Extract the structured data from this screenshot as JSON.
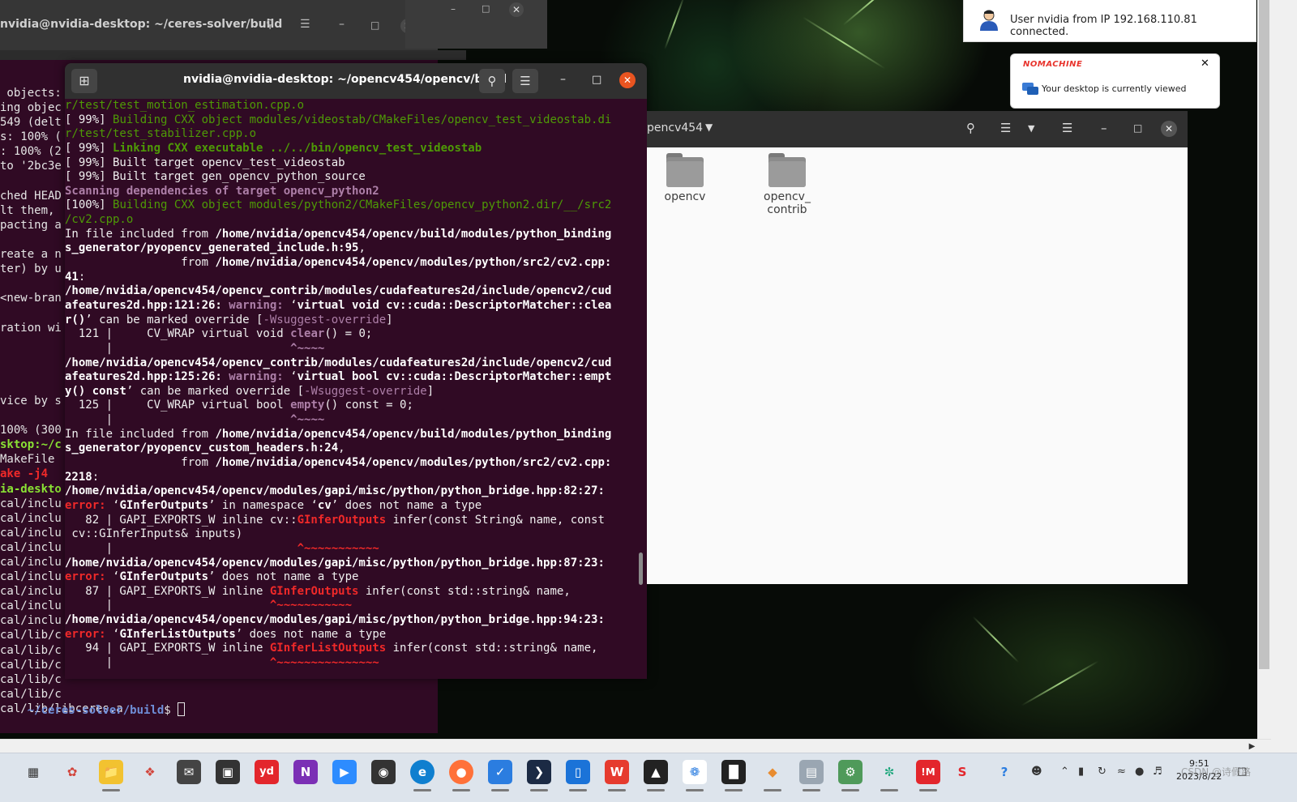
{
  "back_terminal": {
    "title": "nvidia@nvidia-desktop: ~/ceres-solver/build",
    "lines": [
      " objects:",
      "ing objec",
      "549 (delt",
      "s: 100% (",
      ": 100% (2",
      "to '2bc3e",
      "",
      "ched HEAD",
      "lt them,",
      "pacting a",
      "",
      "reate a n",
      "ter) by u",
      "",
      "<new-bran",
      "",
      "ration wi",
      "",
      "",
      "",
      "",
      "vice by s",
      "",
      "100% (300"
    ],
    "blue_lines": [
      "sktop:~/c",
      "MakeFile",
      "ake -j4",
      "ia-deskto"
    ],
    "lib_lines": [
      "cal/inclu",
      "cal/inclu",
      "cal/inclu",
      "cal/inclu",
      "cal/inclu",
      "cal/inclu",
      "cal/inclu",
      "cal/inclu",
      "cal/inclu",
      "cal/lib/c",
      "cal/lib/c",
      "cal/lib/c",
      "cal/lib/c",
      "cal/lib/c",
      "cal/lib/libceres.a"
    ],
    "prompt_path": "~/ceres-solver/build",
    "prompt_suffix": "$ "
  },
  "main_terminal": {
    "title": "nvidia@nvidia-desktop: ~/opencv454/opencv/build",
    "lines": [
      [
        {
          "t": "r/test/test_motion_estimation.cpp.o",
          "c": "g"
        }
      ],
      [
        {
          "t": "[ 99%] ",
          "c": ""
        },
        {
          "t": "Building CXX object modules/videostab/CMakeFiles/opencv_test_videostab.di",
          "c": "g"
        }
      ],
      [
        {
          "t": "r/test/test_stabilizer.cpp.o",
          "c": "g"
        }
      ],
      [
        {
          "t": "[ 99%] ",
          "c": ""
        },
        {
          "t": "Linking CXX executable ../../bin/opencv_test_videostab",
          "c": "gb"
        }
      ],
      [
        {
          "t": "[ 99%] Built target opencv_test_videostab",
          "c": ""
        }
      ],
      [
        {
          "t": "[ 99%] Built target gen_opencv_python_source",
          "c": ""
        }
      ],
      [
        {
          "t": "Scanning dependencies of target opencv_python2",
          "c": "pb"
        }
      ],
      [
        {
          "t": "[100%] ",
          "c": ""
        },
        {
          "t": "Building CXX object modules/python2/CMakeFiles/opencv_python2.dir/__/src2",
          "c": "g"
        }
      ],
      [
        {
          "t": "/cv2.cpp.o",
          "c": "g"
        }
      ],
      [
        {
          "t": "In file included from ",
          "c": ""
        },
        {
          "t": "/home/nvidia/opencv454/opencv/build/modules/python_binding",
          "c": "b"
        }
      ],
      [
        {
          "t": "s_generator/pyopencv_generated_include.h:95",
          "c": "b"
        },
        {
          "t": ",",
          "c": ""
        }
      ],
      [
        {
          "t": "                 from ",
          "c": ""
        },
        {
          "t": "/home/nvidia/opencv454/opencv/modules/python/src2/cv2.cpp:",
          "c": "b"
        }
      ],
      [
        {
          "t": "41",
          "c": "b"
        },
        {
          "t": ":",
          "c": ""
        }
      ],
      [
        {
          "t": "/home/nvidia/opencv454/opencv_contrib/modules/cudafeatures2d/include/opencv2/cud",
          "c": "b"
        }
      ],
      [
        {
          "t": "afeatures2d.hpp:121:26:",
          "c": "b"
        },
        {
          "t": " warning: ",
          "c": "pb"
        },
        {
          "t": "‘",
          "c": ""
        },
        {
          "t": "virtual void cv::cuda::DescriptorMatcher::clea",
          "c": "b"
        }
      ],
      [
        {
          "t": "r()",
          "c": "b"
        },
        {
          "t": "’ can be marked override [",
          "c": ""
        },
        {
          "t": "-Wsuggest-override",
          "c": "purple"
        },
        {
          "t": "]",
          "c": ""
        }
      ],
      [
        {
          "t": "  121 |     CV_WRAP virtual void ",
          "c": ""
        },
        {
          "t": "clear",
          "c": "pb"
        },
        {
          "t": "() = 0;",
          "c": ""
        }
      ],
      [
        {
          "t": "      |                          ",
          "c": ""
        },
        {
          "t": "^~~~~",
          "c": "pb"
        }
      ],
      [
        {
          "t": "/home/nvidia/opencv454/opencv_contrib/modules/cudafeatures2d/include/opencv2/cud",
          "c": "b"
        }
      ],
      [
        {
          "t": "afeatures2d.hpp:125:26:",
          "c": "b"
        },
        {
          "t": " warning: ",
          "c": "pb"
        },
        {
          "t": "‘",
          "c": ""
        },
        {
          "t": "virtual bool cv::cuda::DescriptorMatcher::empt",
          "c": "b"
        }
      ],
      [
        {
          "t": "y() const",
          "c": "b"
        },
        {
          "t": "’ can be marked override [",
          "c": ""
        },
        {
          "t": "-Wsuggest-override",
          "c": "purple"
        },
        {
          "t": "]",
          "c": ""
        }
      ],
      [
        {
          "t": "  125 |     CV_WRAP virtual bool ",
          "c": ""
        },
        {
          "t": "empty",
          "c": "pb"
        },
        {
          "t": "() const = 0;",
          "c": ""
        }
      ],
      [
        {
          "t": "      |                          ",
          "c": ""
        },
        {
          "t": "^~~~~",
          "c": "pb"
        }
      ],
      [
        {
          "t": "In file included from ",
          "c": ""
        },
        {
          "t": "/home/nvidia/opencv454/opencv/build/modules/python_binding",
          "c": "b"
        }
      ],
      [
        {
          "t": "s_generator/pyopencv_custom_headers.h:24",
          "c": "b"
        },
        {
          "t": ",",
          "c": ""
        }
      ],
      [
        {
          "t": "                 from ",
          "c": ""
        },
        {
          "t": "/home/nvidia/opencv454/opencv/modules/python/src2/cv2.cpp:",
          "c": "b"
        }
      ],
      [
        {
          "t": "2218",
          "c": "b"
        },
        {
          "t": ":",
          "c": ""
        }
      ],
      [
        {
          "t": "/home/nvidia/opencv454/opencv/modules/gapi/misc/python/python_bridge.hpp:82:27:",
          "c": "b"
        }
      ],
      [
        {
          "t": "error: ",
          "c": "rb"
        },
        {
          "t": "‘",
          "c": ""
        },
        {
          "t": "GInferOutputs",
          "c": "b"
        },
        {
          "t": "’ in namespace ‘",
          "c": ""
        },
        {
          "t": "cv",
          "c": "b"
        },
        {
          "t": "’ does not name a type",
          "c": ""
        }
      ],
      [
        {
          "t": "   82 | GAPI_EXPORTS_W inline cv::",
          "c": ""
        },
        {
          "t": "GInferOutputs",
          "c": "rb"
        },
        {
          "t": " infer(const String& name, const",
          "c": ""
        }
      ],
      [
        {
          "t": " cv::GInferInputs& inputs)",
          "c": ""
        }
      ],
      [
        {
          "t": "      |                           ",
          "c": ""
        },
        {
          "t": "^~~~~~~~~~~~",
          "c": "rb"
        }
      ],
      [
        {
          "t": "/home/nvidia/opencv454/opencv/modules/gapi/misc/python/python_bridge.hpp:87:23:",
          "c": "b"
        }
      ],
      [
        {
          "t": "error: ",
          "c": "rb"
        },
        {
          "t": "‘",
          "c": ""
        },
        {
          "t": "GInferOutputs",
          "c": "b"
        },
        {
          "t": "’ does not name a type",
          "c": ""
        }
      ],
      [
        {
          "t": "   87 | GAPI_EXPORTS_W inline ",
          "c": ""
        },
        {
          "t": "GInferOutputs",
          "c": "rb"
        },
        {
          "t": " infer(const std::string& name,",
          "c": ""
        }
      ],
      [
        {
          "t": "      |                       ",
          "c": ""
        },
        {
          "t": "^~~~~~~~~~~~",
          "c": "rb"
        }
      ],
      [
        {
          "t": "/home/nvidia/opencv454/opencv/modules/gapi/misc/python/python_bridge.hpp:94:23:",
          "c": "b"
        }
      ],
      [
        {
          "t": "error: ",
          "c": "rb"
        },
        {
          "t": "‘",
          "c": ""
        },
        {
          "t": "GInferListOutputs",
          "c": "b"
        },
        {
          "t": "’ does not name a type",
          "c": ""
        }
      ],
      [
        {
          "t": "   94 | GAPI_EXPORTS_W inline ",
          "c": ""
        },
        {
          "t": "GInferListOutputs",
          "c": "rb"
        },
        {
          "t": " infer(const std::string& name,",
          "c": ""
        }
      ],
      [
        {
          "t": "      |                       ",
          "c": ""
        },
        {
          "t": "^~~~~~~~~~~~~~~~",
          "c": "rb"
        }
      ]
    ]
  },
  "file_manager": {
    "path_label": "pencv454",
    "folders": [
      "opencv",
      "opencv_\ncontrib"
    ]
  },
  "notifications": {
    "connection_text": "User nvidia from IP 192.168.110.81 connected.",
    "brand": "NOMACHINE",
    "viewed_text": "Your desktop is currently viewed"
  },
  "taskbar": {
    "time": "9:51",
    "date": "2023/8/22",
    "watermark": "CSDN @诗假路"
  },
  "icons": {
    "new_tab": "new-tab-icon",
    "search": "search-icon",
    "menu": "hamburger-menu-icon",
    "minimize": "minimize-icon",
    "maximize": "maximize-icon",
    "close": "close-icon"
  },
  "colors": {
    "terminal_bg": "#300a24",
    "terminal_close": "#e95420",
    "build_green": "#4e9a06",
    "warning_purple": "#ad7fa8",
    "error_red": "#ef2929",
    "prompt_blue": "#6f8ed8",
    "nomachine_red": "#e8332c"
  }
}
